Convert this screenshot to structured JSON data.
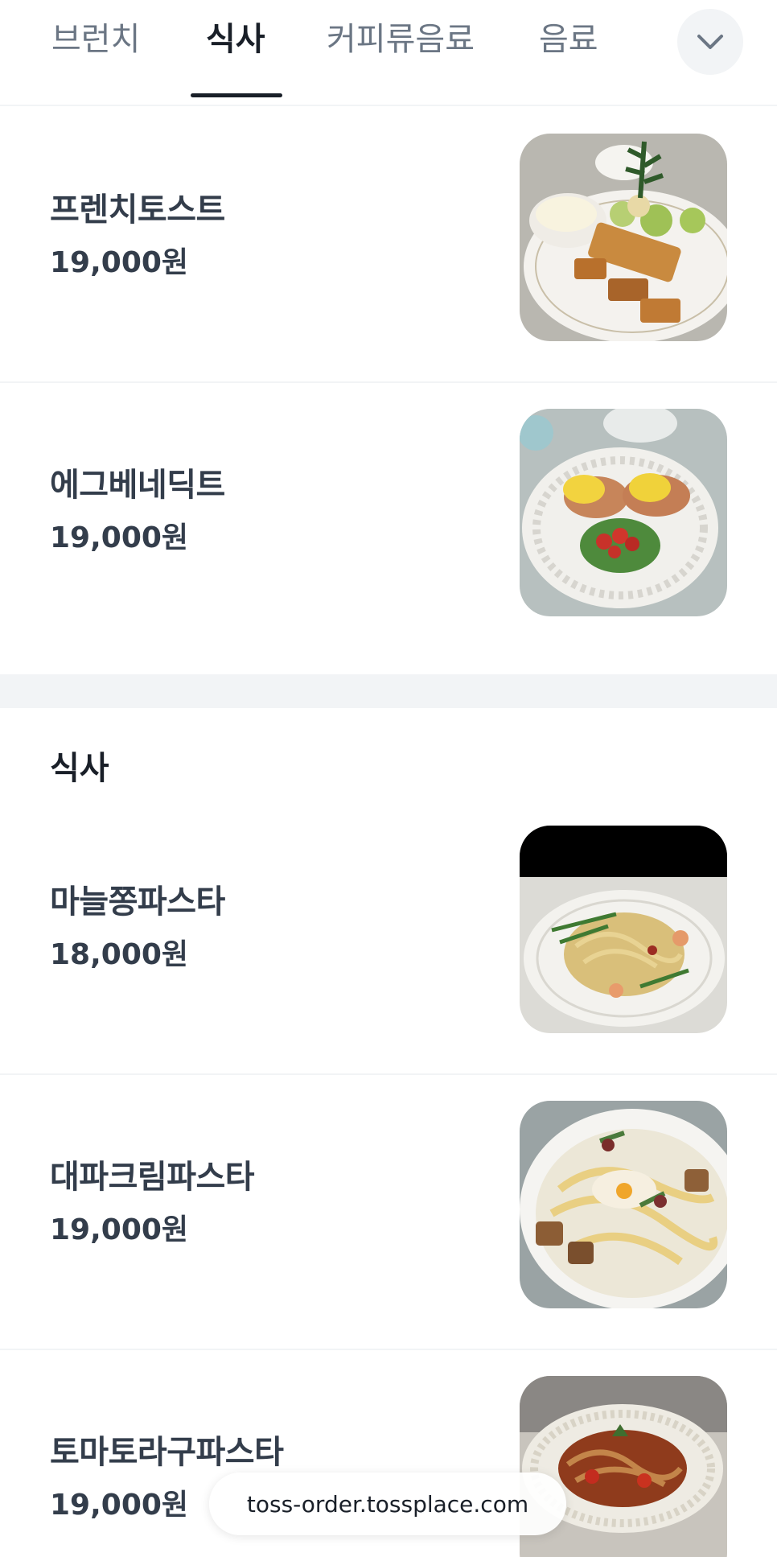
{
  "tabs": [
    {
      "label": "브런치",
      "active": false
    },
    {
      "label": "식사",
      "active": true
    },
    {
      "label": "커피류음료",
      "active": false
    },
    {
      "label": "음료",
      "active": false
    }
  ],
  "more_icon": "chevron-down-icon",
  "brunch_items": [
    {
      "name": "프렌치토스트",
      "price": "19,000원",
      "image": "french-toast-photo"
    },
    {
      "name": "에그베네딕트",
      "price": "19,000원",
      "image": "eggs-benedict-photo"
    }
  ],
  "meal_section": {
    "title": "식사",
    "items": [
      {
        "name": "마늘쫑파스타",
        "price": "18,000원",
        "image": "garlic-scape-pasta-photo"
      },
      {
        "name": "대파크림파스타",
        "price": "19,000원",
        "image": "green-onion-cream-pasta-photo"
      },
      {
        "name": "토마토라구파스타",
        "price": "19,000원",
        "image": "tomato-ragu-pasta-photo"
      }
    ]
  },
  "url": "toss-order.tossplace.com",
  "colors": {
    "text_primary": "#191f28",
    "text_secondary": "#6b7684",
    "divider": "#f2f4f6"
  }
}
